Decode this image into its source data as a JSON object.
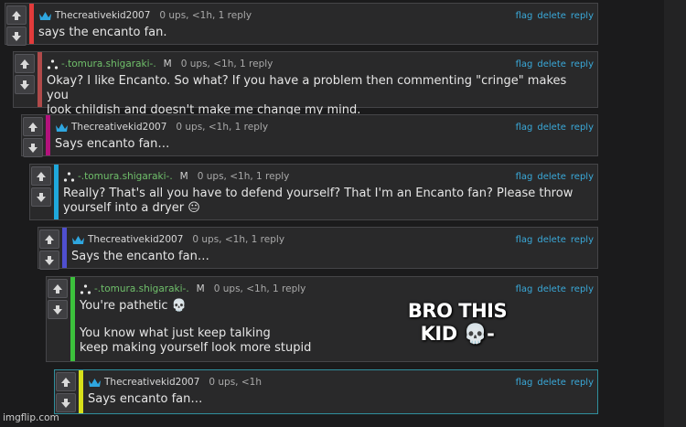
{
  "actions": {
    "flag": "flag",
    "delete": "delete",
    "reply": "reply"
  },
  "colors": {
    "level1": "#e23b3b",
    "level2": "#b04a4a",
    "level3": "#b3127c",
    "level4": "#1fa8dc",
    "level5": "#4f4fcf",
    "level6": "#3cc23c",
    "level7": "#d7e01a",
    "link": "#3aa9d9"
  },
  "comments": [
    {
      "author": "Thecreativekid2007",
      "mod": "",
      "stats": "0 ups, <1h, 1 reply",
      "lines": [
        "says the encanto fan."
      ]
    },
    {
      "author": "-.tomura.shigaraki-.",
      "mod": "M",
      "stats": "0 ups, <1h, 1 reply",
      "lines": [
        "Okay? I like Encanto. So what? If you have a problem then commenting \"cringe\" makes you",
        "look childish and doesn't make me change my mind."
      ]
    },
    {
      "author": "Thecreativekid2007",
      "mod": "",
      "stats": "0 ups, <1h, 1 reply",
      "lines": [
        "Says encanto fan…"
      ]
    },
    {
      "author": "-.tomura.shigaraki-.",
      "mod": "M",
      "stats": "0 ups, <1h, 1 reply",
      "lines": [
        "Really? That's all you have to defend yourself? That I'm an Encanto fan? Please throw",
        "yourself into a dryer 😐"
      ]
    },
    {
      "author": "Thecreativekid2007",
      "mod": "",
      "stats": "0 ups, <1h, 1 reply",
      "lines": [
        "Says the encanto fan…"
      ]
    },
    {
      "author": "-.tomura.shigaraki-.",
      "mod": "M",
      "stats": "0 ups, <1h, 1 reply",
      "lines": [
        "You're pathetic 💀",
        "You know what just keep talking",
        "keep making yourself look more stupid"
      ]
    },
    {
      "author": "Thecreativekid2007",
      "mod": "",
      "stats": "0 ups, <1h",
      "lines": [
        "Says encanto fan…"
      ]
    }
  ],
  "overlay": {
    "line1": "BRO THIS",
    "line2": "KID 💀-"
  },
  "watermark": "imgflip.com"
}
